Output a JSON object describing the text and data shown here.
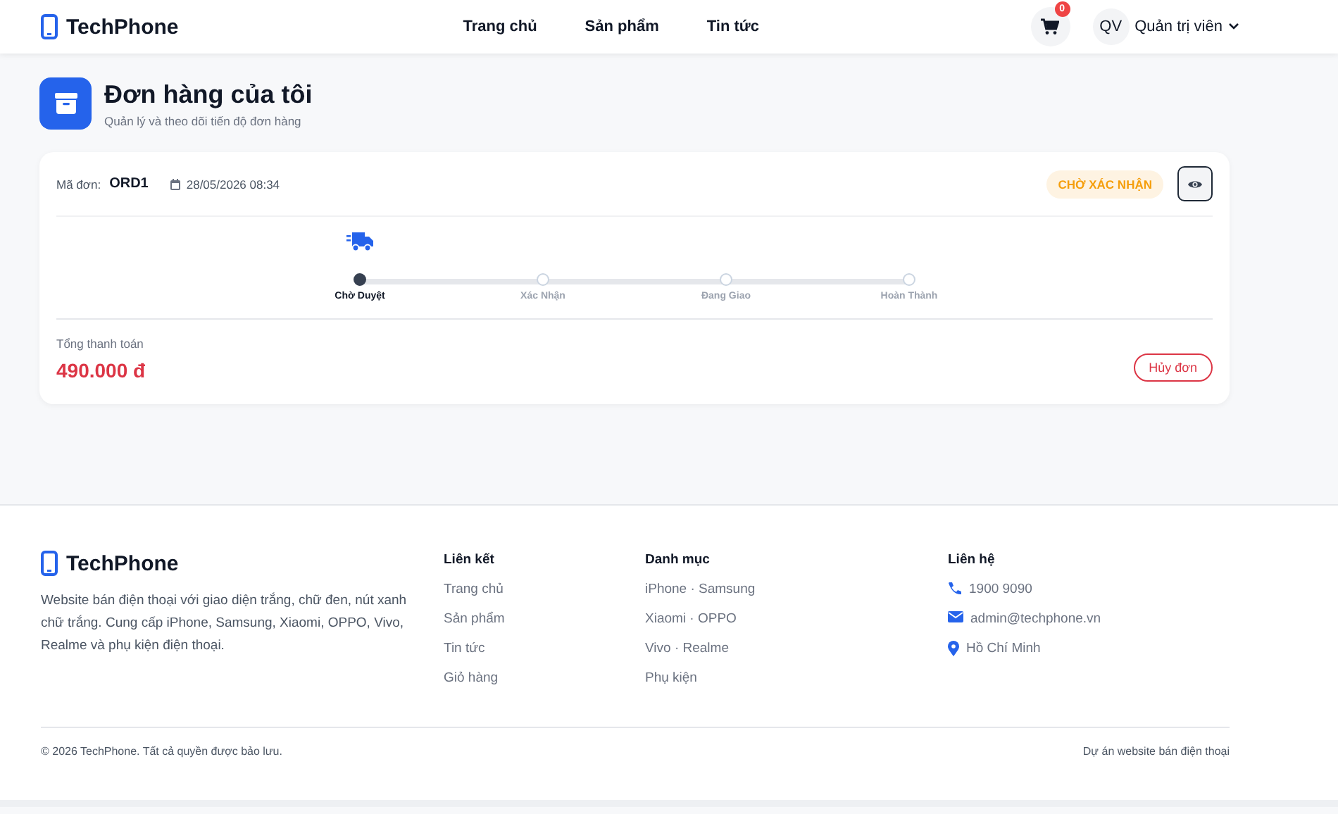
{
  "header": {
    "brand": "TechPhone",
    "nav": [
      {
        "label": "Trang chủ"
      },
      {
        "label": "Sản phẩm"
      },
      {
        "label": "Tin tức"
      }
    ],
    "cart_count": "0",
    "avatar": "QV",
    "user_name": "Quản trị viên"
  },
  "page": {
    "title": "Đơn hàng của tôi",
    "subtitle": "Quản lý và theo dõi tiến độ đơn hàng"
  },
  "orders": [
    {
      "code_label": "Mã đơn:",
      "code": "ORD1",
      "date": "28/05/2026 08:34",
      "status": "CHỜ XÁC NHẬN",
      "steps": [
        {
          "label": "Chờ Duyệt",
          "selected": true
        },
        {
          "label": "Xác Nhận",
          "selected": false
        },
        {
          "label": "Đang Giao",
          "selected": false
        },
        {
          "label": "Hoàn Thành",
          "selected": false
        }
      ],
      "total_label": "Tổng thanh toán",
      "total": "490.000 đ",
      "cancel": "Hủy đơn"
    }
  ],
  "footer": {
    "brand": "TechPhone",
    "description": "Website bán điện thoại với giao diện trắng, chữ đen, nút xanh chữ trắng. Cung cấp iPhone, Samsung, Xiaomi, OPPO, Vivo, Realme và phụ kiện điện thoại.",
    "columns": [
      {
        "title": "Liên kết",
        "items": [
          {
            "label": "Trang chủ"
          },
          {
            "label": "Sản phẩm"
          },
          {
            "label": "Tin tức"
          },
          {
            "label": "Giỏ hàng"
          }
        ]
      },
      {
        "title": "Danh mục",
        "items": [
          {
            "label": "iPhone · Samsung"
          },
          {
            "label": "Xiaomi · OPPO"
          },
          {
            "label": "Vivo · Realme"
          },
          {
            "label": "Phụ kiện"
          }
        ]
      },
      {
        "title": "Liên hệ",
        "items": [
          {
            "label": "1900 9090",
            "kind": "phone"
          },
          {
            "label": "admin@techphone.vn",
            "kind": "email"
          },
          {
            "label": "Hồ Chí Minh",
            "kind": "location"
          }
        ]
      }
    ],
    "copyright": "© 2026 TechPhone. Tất cả quyền được bảo lưu.",
    "note": "Dự án website bán điện thoại"
  }
}
